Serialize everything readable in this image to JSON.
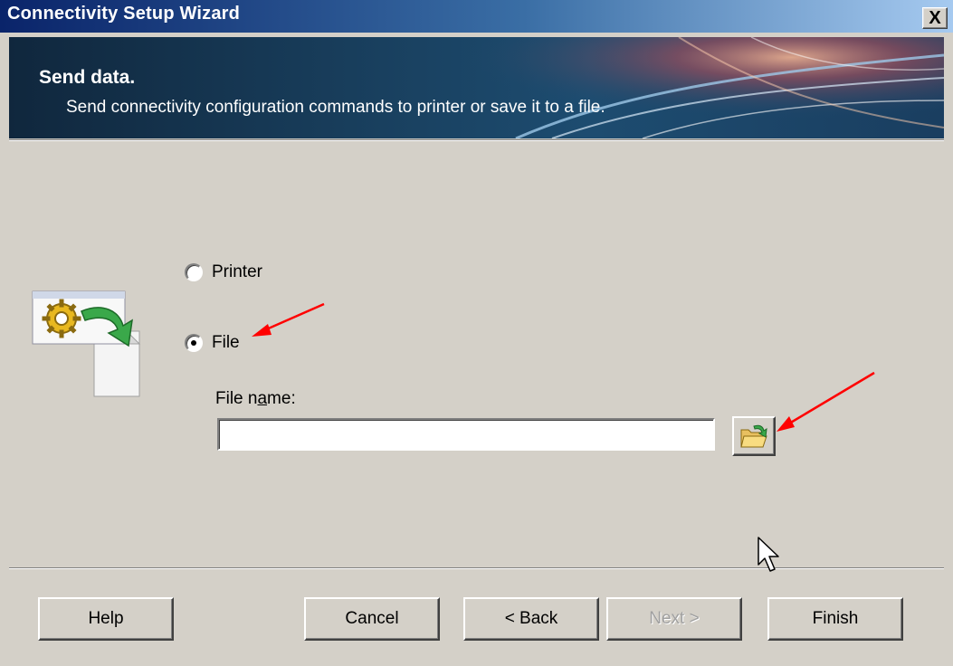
{
  "window": {
    "title": "Connectivity Setup Wizard",
    "close_glyph": "X"
  },
  "header": {
    "title": "Send data.",
    "subtitle": "Send connectivity configuration commands to printer or save it to a file."
  },
  "options": {
    "printer_label": "Printer",
    "file_label": "File",
    "selected": "File"
  },
  "file": {
    "label_pre": "File n",
    "label_accel": "a",
    "label_post": "me:",
    "value": "",
    "browse_icon": "open-folder-icon"
  },
  "buttons": {
    "help": "Help",
    "cancel": "Cancel",
    "back": "< Back",
    "next": "Next >",
    "finish": "Finish"
  },
  "colors": {
    "annotation_arrow": "#ff0000",
    "dialog_bg": "#d4d0c8"
  }
}
